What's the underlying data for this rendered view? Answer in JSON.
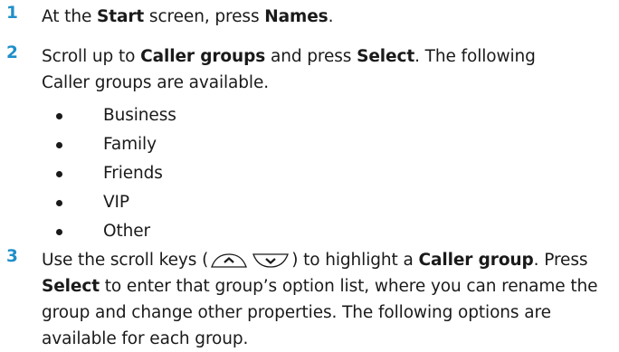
{
  "steps": [
    {
      "number": "1",
      "text": {
        "t1": "At the ",
        "b1": "Start",
        "t2": " screen, press ",
        "b2": "Names",
        "t3": "."
      }
    },
    {
      "number": "2",
      "text": {
        "t1": "Scroll up to ",
        "b1": "Caller groups",
        "t2": " and press ",
        "b2": "Select",
        "t3": ". The following Caller groups are available."
      },
      "groups": [
        "Business",
        "Family",
        "Friends",
        "VIP",
        "Other"
      ]
    },
    {
      "number": "3",
      "text": {
        "t1": "Use the scroll keys (",
        "t2": ") to highlight a ",
        "b1": "Caller group",
        "t3": ". Press ",
        "b2": "Select",
        "t4": " to enter that group’s option list, where you can rename the group and change other properties. The following options are available for each group."
      },
      "icons": [
        "scroll-up-key-icon",
        "scroll-down-key-icon"
      ]
    }
  ],
  "colors": {
    "step_number": "#1f8fc9",
    "text": "#1a1a1a"
  }
}
